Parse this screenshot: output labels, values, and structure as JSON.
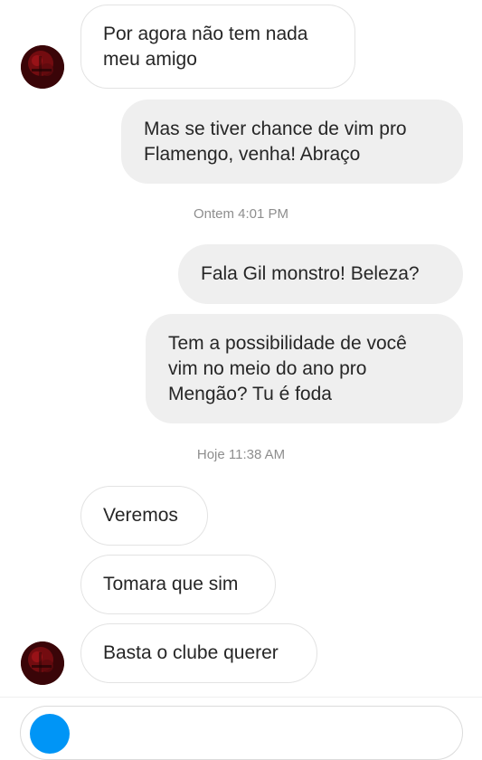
{
  "messages": [
    {
      "text": "Por agora não tem nada\nmeu amigo",
      "direction": "incoming"
    },
    {
      "text": "Mas se tiver chance de vim pro\nFlamengo, venha! Abraço",
      "direction": "outgoing"
    },
    {
      "text": "Fala Gil monstro! Beleza?",
      "direction": "outgoing"
    },
    {
      "text": "Tem a possibilidade de você\nvim no meio do ano pro\nMengão? Tu é foda",
      "direction": "outgoing"
    },
    {
      "text": "Veremos",
      "direction": "incoming"
    },
    {
      "text": "Tomara que sim",
      "direction": "incoming"
    },
    {
      "text": "Basta o clube querer",
      "direction": "incoming"
    }
  ],
  "timestamps": [
    "Ontem 4:01 PM",
    "Hoje 11:38 AM"
  ],
  "colors": {
    "incoming_bubble_border": "#e3e3e3",
    "outgoing_bubble_bg": "#efefef",
    "timestamp_text": "#8e8e8e",
    "accent_blue": "#0095f6",
    "avatar_red": "#8a0f14"
  },
  "icons": {
    "avatar": "contact-avatar",
    "composer_camera": "camera-icon"
  }
}
